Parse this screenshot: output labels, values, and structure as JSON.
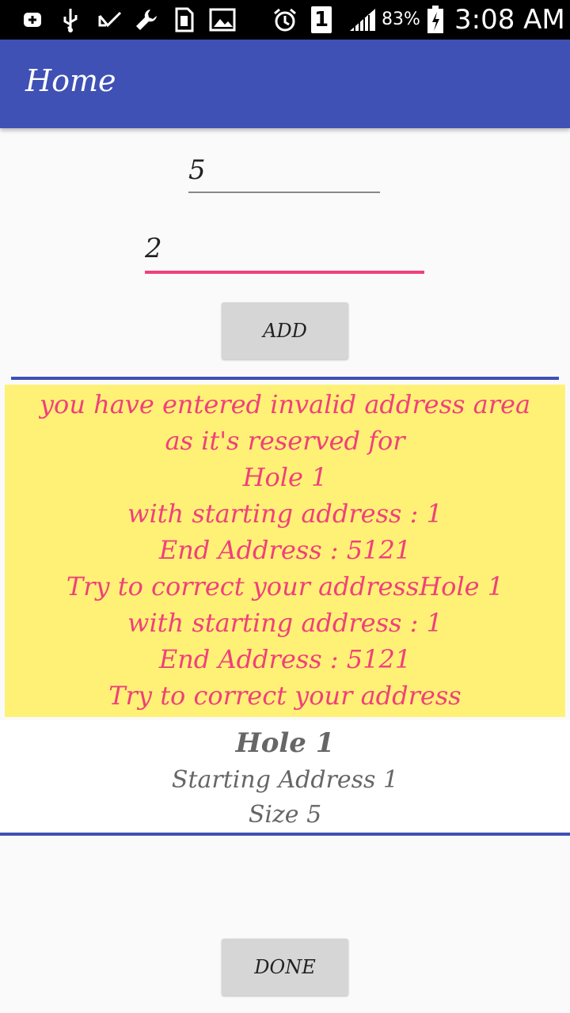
{
  "status_bar": {
    "icons": [
      "add-box-icon",
      "usb-icon",
      "check-icon",
      "wrench-icon",
      "sim-icon",
      "image-icon",
      "alarm-icon",
      "sim-slot-icon",
      "signal-icon",
      "battery-icon"
    ],
    "sim_label": "1",
    "battery_percent": "83%",
    "time": "3:08 AM"
  },
  "app_bar": {
    "title": "Home"
  },
  "form": {
    "first_value": "5",
    "second_value": "2",
    "add_label": "ADD"
  },
  "warning": {
    "lines": [
      "you have entered invalid address area",
      "as it's reserved for",
      "Hole 1",
      "with starting address : 1",
      "End Address : 5121",
      "Try to correct your addressHole 1",
      "with starting address : 1",
      "End Address : 5121",
      "Try to correct your address"
    ]
  },
  "hole": {
    "title": "Hole 1",
    "start_line": "Starting Address  1",
    "size_line": "Size 5"
  },
  "done_label": "DONE",
  "colors": {
    "primary": "#3f51b5",
    "accent": "#f0407a",
    "warning_bg": "#fff176"
  }
}
